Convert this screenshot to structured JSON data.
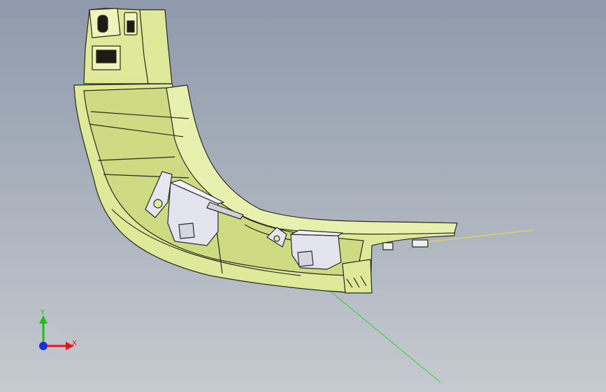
{
  "scene": {
    "colors": {
      "part_body": "#e2ec9e",
      "part_shade": "#c9d77c",
      "part_edge": "#2a2a1a",
      "connector": "#e4e4ee",
      "x_axis": "#e01818",
      "y_axis": "#18c018",
      "z_axis": "#1830e0",
      "ref_line_x": "#f0e040",
      "ref_line_y": "#30d030"
    }
  },
  "triad": {
    "x_label": "X",
    "y_label": "Y"
  }
}
